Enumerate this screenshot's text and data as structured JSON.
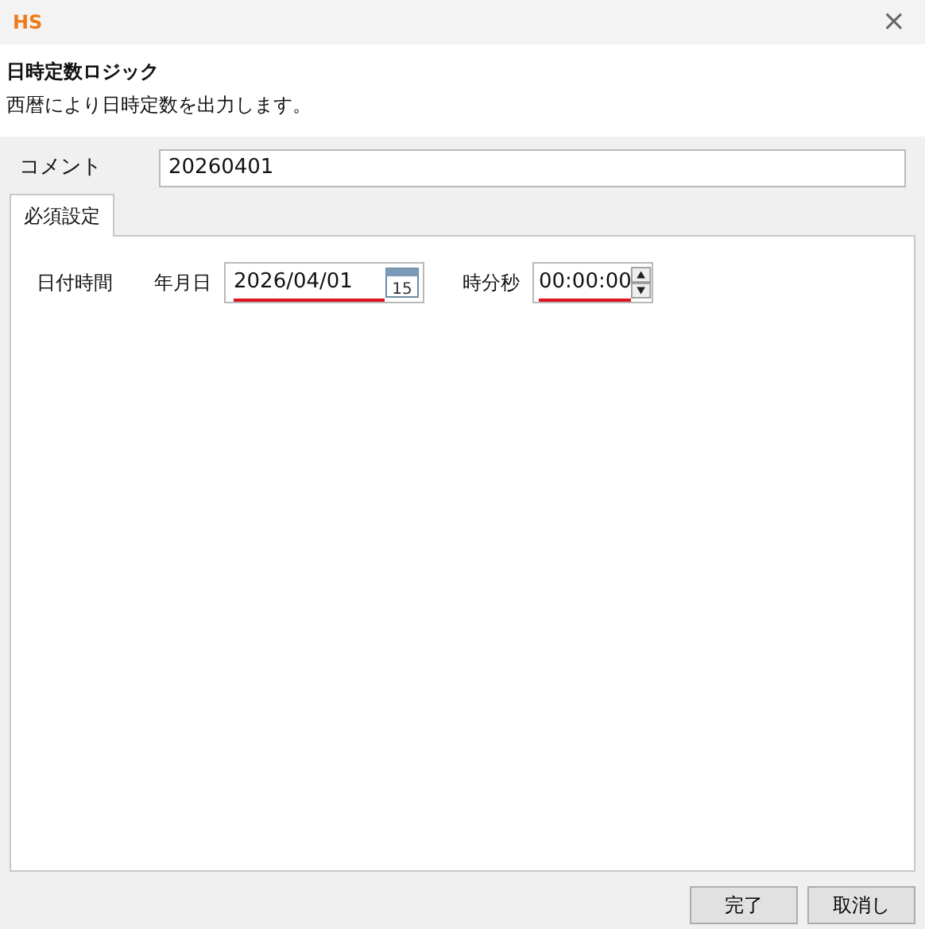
{
  "window": {
    "logo": "HS",
    "close": "×"
  },
  "header": {
    "title": "日時定数ロジック",
    "description": "西暦により日時定数を出力します。"
  },
  "comment": {
    "label": "コメント",
    "value": "20260401"
  },
  "tabs": [
    {
      "label": "必須設定",
      "selected": true
    }
  ],
  "panel": {
    "group_label": "日付時間",
    "date": {
      "label": "年月日",
      "value": "2026/04/01",
      "calendar_day": "15",
      "underlined": true
    },
    "time": {
      "label": "時分秒",
      "value": "00:00:00",
      "underlined": true
    }
  },
  "buttons": [
    "完了",
    "取消し"
  ]
}
